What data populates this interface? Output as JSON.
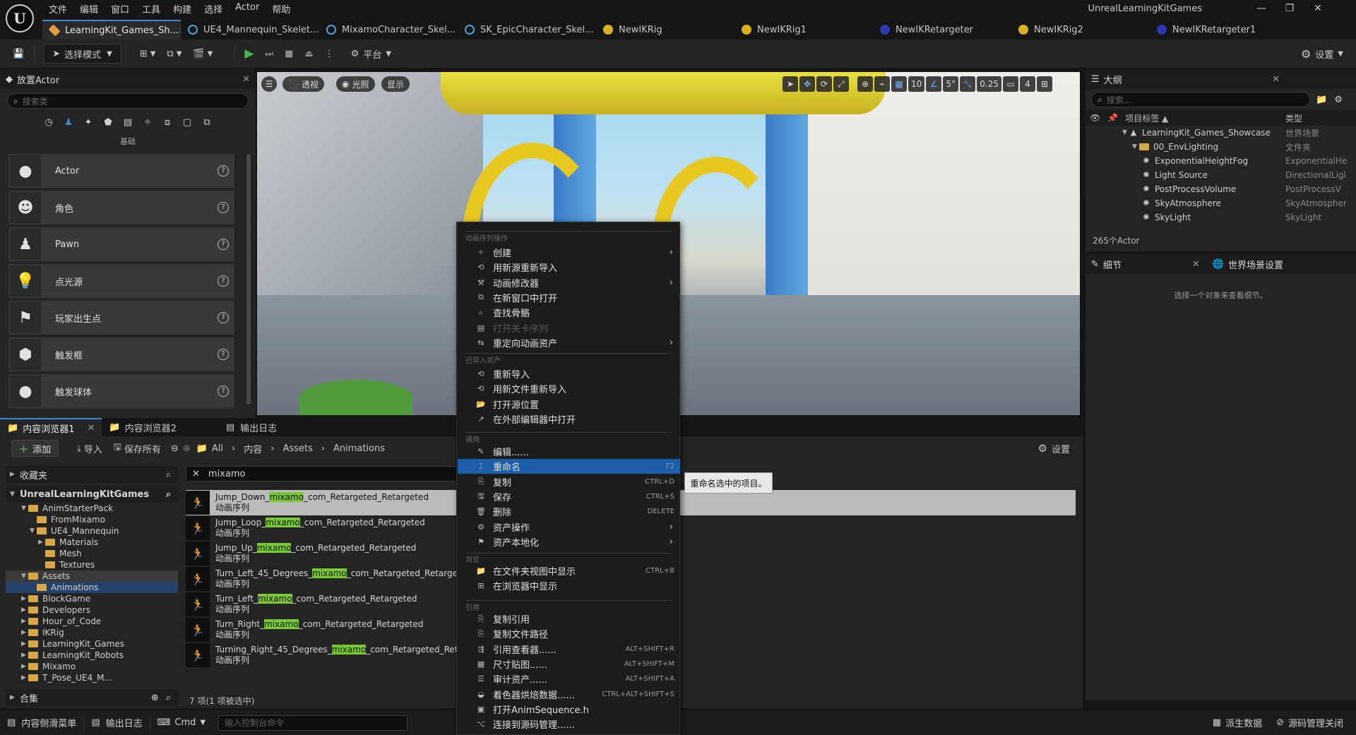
{
  "window": {
    "project_name": "UnrealLearningKitGames",
    "logo": "U"
  },
  "menubar": [
    "文件",
    "编辑",
    "窗口",
    "工具",
    "构建",
    "选择",
    "Actor",
    "帮助"
  ],
  "tabs": [
    {
      "label": "LearningKit_Games_Sh...",
      "icon": "level-icon"
    },
    {
      "label": "UE4_Mannequin_Skelet...",
      "icon": "skeleton-icon"
    },
    {
      "label": "MixamoCharacter_Skel...",
      "icon": "skeleton-icon"
    },
    {
      "label": "SK_EpicCharacter_Skel...",
      "icon": "skeleton-icon"
    },
    {
      "label": "NewIKRig",
      "icon": "ikrig-icon"
    },
    {
      "label": "NewIKRig1",
      "icon": "ikrig-icon"
    },
    {
      "label": "NewIKRetargeter",
      "icon": "retargeter-icon"
    },
    {
      "label": "NewIKRig2",
      "icon": "ikrig-icon"
    },
    {
      "label": "NewIKRetargeter1",
      "icon": "retargeter-icon"
    }
  ],
  "toolbar": {
    "mode_label": "选择模式",
    "platform_label": "平台",
    "settings_label": "设置"
  },
  "place_actors": {
    "title": "放置Actor",
    "search_placeholder": "搜索类",
    "category_label": "基础",
    "items": [
      {
        "label": "Actor",
        "icon": "sphere-icon"
      },
      {
        "label": "角色",
        "icon": "character-icon"
      },
      {
        "label": "Pawn",
        "icon": "pawn-icon"
      },
      {
        "label": "点光源",
        "icon": "bulb-icon"
      },
      {
        "label": "玩家出生点",
        "icon": "flag-icon"
      },
      {
        "label": "触发框",
        "icon": "box-icon"
      },
      {
        "label": "触发球体",
        "icon": "sphere-icon"
      }
    ]
  },
  "viewport": {
    "perspective": "透视",
    "lighting": "光照",
    "show": "显示",
    "grid_snap": "10",
    "rotation_snap": "5°",
    "scale_snap": "0.25",
    "camera_speed": "4"
  },
  "outliner": {
    "title": "大纲",
    "search_placeholder": "搜索...",
    "col_label": "项目标签 ▲",
    "col_type": "类型",
    "rows": [
      {
        "label": "LearningKit_Games_Showcase",
        "type": "世界场景",
        "indent": 0
      },
      {
        "label": "00_EnvLighting",
        "type": "文件夹",
        "indent": 1
      },
      {
        "label": "ExponentialHeightFog",
        "type": "ExponentialHe",
        "indent": 2
      },
      {
        "label": "Light Source",
        "type": "DirectionalLigl",
        "indent": 2
      },
      {
        "label": "PostProcessVolume",
        "type": "PostProcessV",
        "indent": 2
      },
      {
        "label": "SkyAtmosphere",
        "type": "SkyAtmospher",
        "indent": 2
      },
      {
        "label": "SkyLight",
        "type": "SkyLight",
        "indent": 2
      }
    ],
    "count": "265个Actor"
  },
  "details": {
    "tab_details": "细节",
    "tab_world": "世界场景设置",
    "empty_text": "选择一个对象来查看细节。"
  },
  "content_browser": {
    "tabs": [
      "内容浏览器1",
      "内容浏览器2",
      "输出日志"
    ],
    "add_label": "添加",
    "import_label": "导入",
    "save_all_label": "保存所有",
    "breadcrumb": [
      "All",
      "内容",
      "Assets",
      "Animations"
    ],
    "settings_label": "设置",
    "favorites": "收藏夹",
    "project_root": "UnrealLearningKitGames",
    "collections": "合集",
    "filter_text": "mixamo",
    "folders": [
      {
        "label": "AnimStarterPack",
        "indent": 1,
        "expanded": true
      },
      {
        "label": "FromMixamo",
        "indent": 2,
        "expanded": false
      },
      {
        "label": "UE4_Mannequin",
        "indent": 2,
        "expanded": true
      },
      {
        "label": "Materials",
        "indent": 3,
        "expanded": false
      },
      {
        "label": "Mesh",
        "indent": 3,
        "expanded": false
      },
      {
        "label": "Textures",
        "indent": 3,
        "expanded": false
      },
      {
        "label": "Assets",
        "indent": 1,
        "expanded": true
      },
      {
        "label": "Animations",
        "indent": 2,
        "expanded": false
      },
      {
        "label": "BlockGame",
        "indent": 1,
        "expanded": false
      },
      {
        "label": "Developers",
        "indent": 1,
        "expanded": false
      },
      {
        "label": "Hour_of_Code",
        "indent": 1,
        "expanded": false
      },
      {
        "label": "IKRig",
        "indent": 1,
        "expanded": false
      },
      {
        "label": "LearningKit_Games",
        "indent": 1,
        "expanded": false
      },
      {
        "label": "LearningKit_Robots",
        "indent": 1,
        "expanded": false
      },
      {
        "label": "Mixamo",
        "indent": 1,
        "expanded": false
      },
      {
        "label": "T_Pose_UE4_M...",
        "indent": 1,
        "expanded": false
      }
    ],
    "assets": [
      {
        "pre": "Jump_Down_",
        "match": "mixamo",
        "post": "_com_Retargeted_Retargeted",
        "type": "动画序列"
      },
      {
        "pre": "Jump_Loop_",
        "match": "mixamo",
        "post": "_com_Retargeted_Retargeted",
        "type": "动画序列"
      },
      {
        "pre": "Jump_Up_",
        "match": "mixamo",
        "post": "_com_Retargeted_Retargeted",
        "type": "动画序列"
      },
      {
        "pre": "Turn_Left_45_Degrees_",
        "match": "mixamo",
        "post": "_com_Retargeted_Retargeted",
        "type": "动画序列"
      },
      {
        "pre": "Turn_Left_",
        "match": "mixamo",
        "post": "_com_Retargeted_Retargeted",
        "type": "动画序列"
      },
      {
        "pre": "Turn_Right_",
        "match": "mixamo",
        "post": "_com_Retargeted_Retargeted",
        "type": "动画序列"
      },
      {
        "pre": "Turning_Right_45_Degrees_",
        "match": "mixamo",
        "post": "_com_Retargeted_Retargete",
        "type": "动画序列"
      }
    ],
    "status": "7 项(1 项被选中)"
  },
  "context_menu": {
    "sections": {
      "anim": "动画序列操作",
      "imported": "已导入资产",
      "common": "通用",
      "explore": "浏览",
      "reference": "引用"
    },
    "anim_items": [
      {
        "label": "创建",
        "icon": "create-icon",
        "submenu": true
      },
      {
        "label": "用新源重新导入",
        "icon": "reimport-icon"
      },
      {
        "label": "动画修改器",
        "icon": "modifier-icon",
        "submenu": true
      },
      {
        "label": "在新窗口中打开",
        "icon": "open-window-icon"
      },
      {
        "label": "查找骨骼",
        "icon": "find-icon"
      },
      {
        "label": "打开关卡序列",
        "icon": "sequence-icon",
        "disabled": true
      },
      {
        "label": "重定向动画资产",
        "icon": "retarget-icon",
        "submenu": true
      }
    ],
    "imported_items": [
      {
        "label": "重新导入",
        "icon": "reimport-icon"
      },
      {
        "label": "用新文件重新导入",
        "icon": "reimport-file-icon"
      },
      {
        "label": "打开源位置",
        "icon": "folder-open-icon"
      },
      {
        "label": "在外部编辑器中打开",
        "icon": "external-icon"
      }
    ],
    "common_items": [
      {
        "label": "编辑......",
        "icon": "edit-icon"
      },
      {
        "label": "重命名",
        "icon": "rename-icon",
        "shortcut": "F2",
        "selected": true
      },
      {
        "label": "复制",
        "icon": "duplicate-icon",
        "shortcut": "CTRL+D"
      },
      {
        "label": "保存",
        "icon": "save-icon",
        "shortcut": "CTRL+S"
      },
      {
        "label": "删除",
        "icon": "delete-icon",
        "shortcut": "DELETE"
      },
      {
        "label": "资产操作",
        "icon": "asset-actions-icon",
        "submenu": true
      },
      {
        "label": "资产本地化",
        "icon": "localize-icon",
        "submenu": true
      }
    ],
    "explore_items": [
      {
        "label": "在文件夹视图中显示",
        "icon": "folder-view-icon",
        "shortcut": "CTRL+B"
      },
      {
        "label": "在浏览器中显示",
        "icon": "browser-icon"
      }
    ],
    "reference_items": [
      {
        "label": "复制引用",
        "icon": "copy-ref-icon"
      },
      {
        "label": "复制文件路径",
        "icon": "copy-path-icon"
      },
      {
        "label": "引用查看器......",
        "icon": "ref-viewer-icon",
        "shortcut": "ALT+SHIFT+R"
      },
      {
        "label": "尺寸贴图......",
        "icon": "size-map-icon",
        "shortcut": "ALT+SHIFT+M"
      },
      {
        "label": "审计资产......",
        "icon": "audit-icon",
        "shortcut": "ALT+SHIFT+A"
      },
      {
        "label": "着色器烘焙数据......",
        "icon": "shader-icon",
        "shortcut": "CTRL+ALT+SHIFT+S"
      },
      {
        "label": "打开AnimSequence.h",
        "icon": "code-icon"
      },
      {
        "label": "连接到源码管理......",
        "icon": "source-control-icon"
      }
    ],
    "tooltip": "重命名选中的项目。"
  },
  "statusbar": {
    "content_drawer": "内容侧滑菜单",
    "output_log": "输出日志",
    "cmd": "Cmd",
    "console_placeholder": "输入控制台命令",
    "derived_data": "派生数据",
    "source_control": "源码管理关闭"
  }
}
